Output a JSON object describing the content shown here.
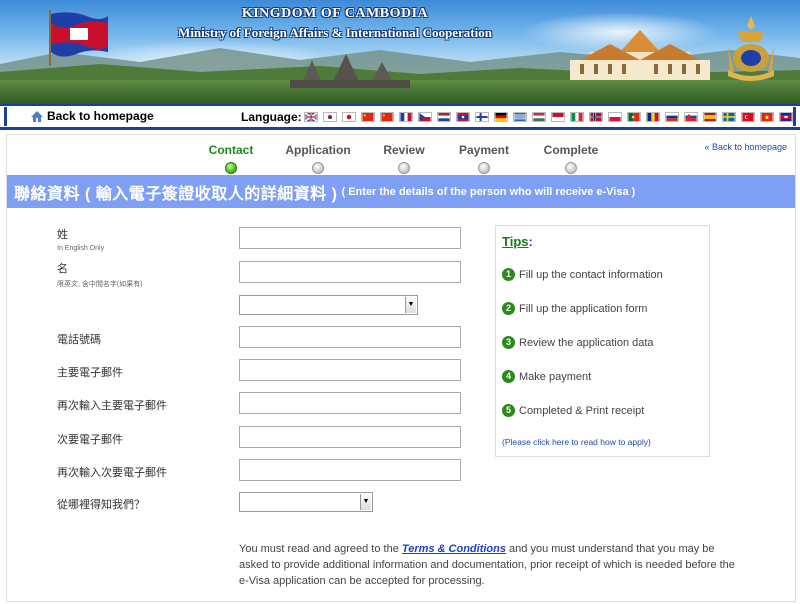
{
  "banner": {
    "title_line1": "KINGDOM OF CAMBODIA",
    "title_line2": "Ministry of Foreign Affairs & International Cooperation"
  },
  "navbar": {
    "back_label": "Back to homepage",
    "language_label": "Language:",
    "flags": [
      "english",
      "korean",
      "japanese",
      "chinese-simplified",
      "chinese-traditional",
      "french",
      "czech",
      "dutch",
      "lao",
      "finnish",
      "german",
      "greek",
      "hungarian",
      "indonesian",
      "italian",
      "norwegian",
      "polish",
      "portuguese",
      "romanian",
      "russian",
      "slovak",
      "spanish",
      "swedish",
      "turkish",
      "vietnamese",
      "khmer"
    ]
  },
  "steps": [
    {
      "label": "Contact",
      "active": true
    },
    {
      "label": "Application",
      "active": false
    },
    {
      "label": "Review",
      "active": false
    },
    {
      "label": "Payment",
      "active": false
    },
    {
      "label": "Complete",
      "active": false
    }
  ],
  "top_back_label": "« Back to homepage",
  "section": {
    "title_zh": "聯絡資料 ( 輸入電子簽證收取人的詳細資料 )",
    "title_en": "( Enter the details of the person who will receive e-Visa )"
  },
  "form": {
    "surname_label": "姓",
    "surname_sub": "In English Only",
    "given_label": "名",
    "given_sub": "限英文, 含中間名字(如果有)",
    "phone_label": "電話號碼",
    "email_label": "主要電子郵件",
    "email_confirm_label": "再次輸入主要電子郵件",
    "email2_label": "次要電子郵件",
    "email2_confirm_label": "再次輸入次要電子郵件",
    "referral_label": "從哪裡得知我們？",
    "values": {
      "surname": "",
      "given": "",
      "phone": "",
      "email": "",
      "email_confirm": "",
      "email2": "",
      "email2_confirm": ""
    }
  },
  "tips": {
    "title": "Tips",
    "colon": ":",
    "items": [
      {
        "num": "1",
        "text": "Fill up the contact information"
      },
      {
        "num": "2",
        "text": "Fill up the application form"
      },
      {
        "num": "3",
        "text": "Review the application data"
      },
      {
        "num": "4",
        "text": "Make payment"
      },
      {
        "num": "5",
        "text": "Completed & Print receipt"
      }
    ],
    "howto": "(Please click here to read how to apply)"
  },
  "terms": {
    "before": "You must read and agreed to the ",
    "link": "Terms & Conditions",
    "after": " and you must understand that you may be asked to provide additional information and documentation, prior receipt of which is needed before the e-Visa application can be accepted for processing."
  }
}
